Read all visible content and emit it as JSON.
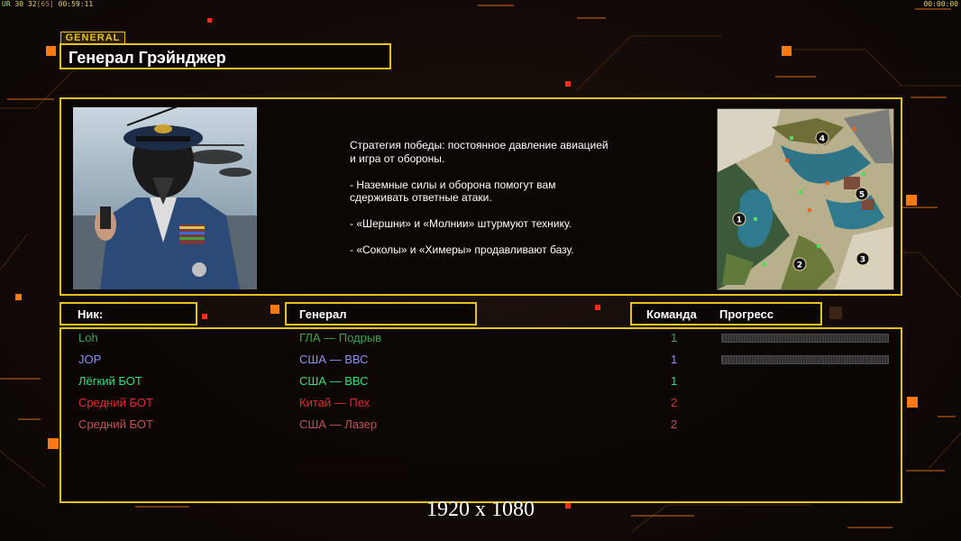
{
  "hud": {
    "left_prefix": "UR",
    "left_values": "30 32",
    "left_bracket": "[65]",
    "left_time": "00:59:11",
    "right_time": "00:00:00"
  },
  "general_tag": "GENERAL",
  "title": "Генерал Грэйнджер",
  "strategy_text": "Стратегия победы: постоянное давление авиацией\n и игра от обороны.\n\n- Наземные силы и оборона помогут вам\n сдерживать ответные атаки.\n\n- «Шершни» и «Молнии» штурмуют технику.\n\n- «Соколы» и «Химеры» продавливают базу.",
  "minimap": {
    "start_markers": [
      "1",
      "2",
      "3",
      "4",
      "5"
    ]
  },
  "headers": {
    "nick": "Ник:",
    "general": "Генерал",
    "team": "Команда",
    "progress": "Прогресс"
  },
  "players": [
    {
      "nick": "Loh",
      "general": "ГЛА — Подрыв",
      "team": "1",
      "color": "#3fa64a",
      "show_progress": true
    },
    {
      "nick": "JOP",
      "general": "США — ВВС",
      "team": "1",
      "color": "#8f8ff0",
      "show_progress": true
    },
    {
      "nick": "Лёгкий БОТ",
      "general": "США — ВВС",
      "team": "1",
      "color": "#33e07a",
      "show_progress": false
    },
    {
      "nick": "Средний БОТ",
      "general": "Китай — Пех",
      "team": "2",
      "color": "#e82a2a",
      "show_progress": false
    },
    {
      "nick": "Средний БОТ",
      "general": "США — Лазер",
      "team": "2",
      "color": "#c05454",
      "show_progress": false
    }
  ],
  "resolution_label": "1920 x 1080",
  "colors": {
    "accent": "#e7c21f",
    "background": "#120a07",
    "orange_square": "#ff7a14"
  }
}
